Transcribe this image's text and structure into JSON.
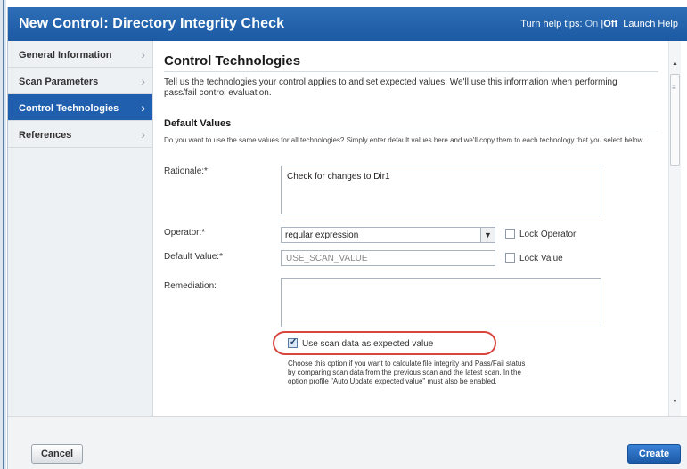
{
  "window": {
    "title": "New Control: Directory Integrity Check",
    "help_tips_label": "Turn help tips:",
    "help_on": "On",
    "help_sep": "|",
    "help_off": "Off",
    "launch_help": "Launch Help"
  },
  "sidebar": {
    "items": [
      {
        "label": "General Information",
        "active": false
      },
      {
        "label": "Scan Parameters",
        "active": false
      },
      {
        "label": "Control Technologies",
        "active": true
      },
      {
        "label": "References",
        "active": false
      }
    ]
  },
  "main": {
    "title": "Control Technologies",
    "intro": "Tell us the technologies your control applies to and set expected values. We'll use this information when performing pass/fail control evaluation.",
    "default_values_heading": "Default Values",
    "default_values_note": "Do you want to use the same values for all technologies? Simply enter default values here and we'll copy them to each technology that you select below.",
    "rationale_label": "Rationale:*",
    "rationale_value": "Check for changes to Dir1",
    "operator_label": "Operator:*",
    "operator_value": "regular expression",
    "lock_operator_label": "Lock Operator",
    "lock_operator_checked": false,
    "default_value_label": "Default Value:*",
    "default_value_placeholder": "USE_SCAN_VALUE",
    "lock_value_label": "Lock Value",
    "lock_value_checked": false,
    "remediation_label": "Remediation:",
    "remediation_value": "",
    "use_scan_data_label": "Use scan data as expected value",
    "use_scan_data_checked": true,
    "use_scan_data_help": "Choose this option if you want to calculate file integrity and Pass/Fail status by comparing scan data from the previous scan and the latest scan. In the option profile \"Auto Update expected value\" must also be enabled."
  },
  "footer": {
    "cancel_label": "Cancel",
    "create_label": "Create"
  },
  "colors": {
    "title_bar": "#1f5fae",
    "active_nav": "#1f5fae",
    "highlight_oval": "#d9463e",
    "create_button": "#1c5aa8"
  }
}
